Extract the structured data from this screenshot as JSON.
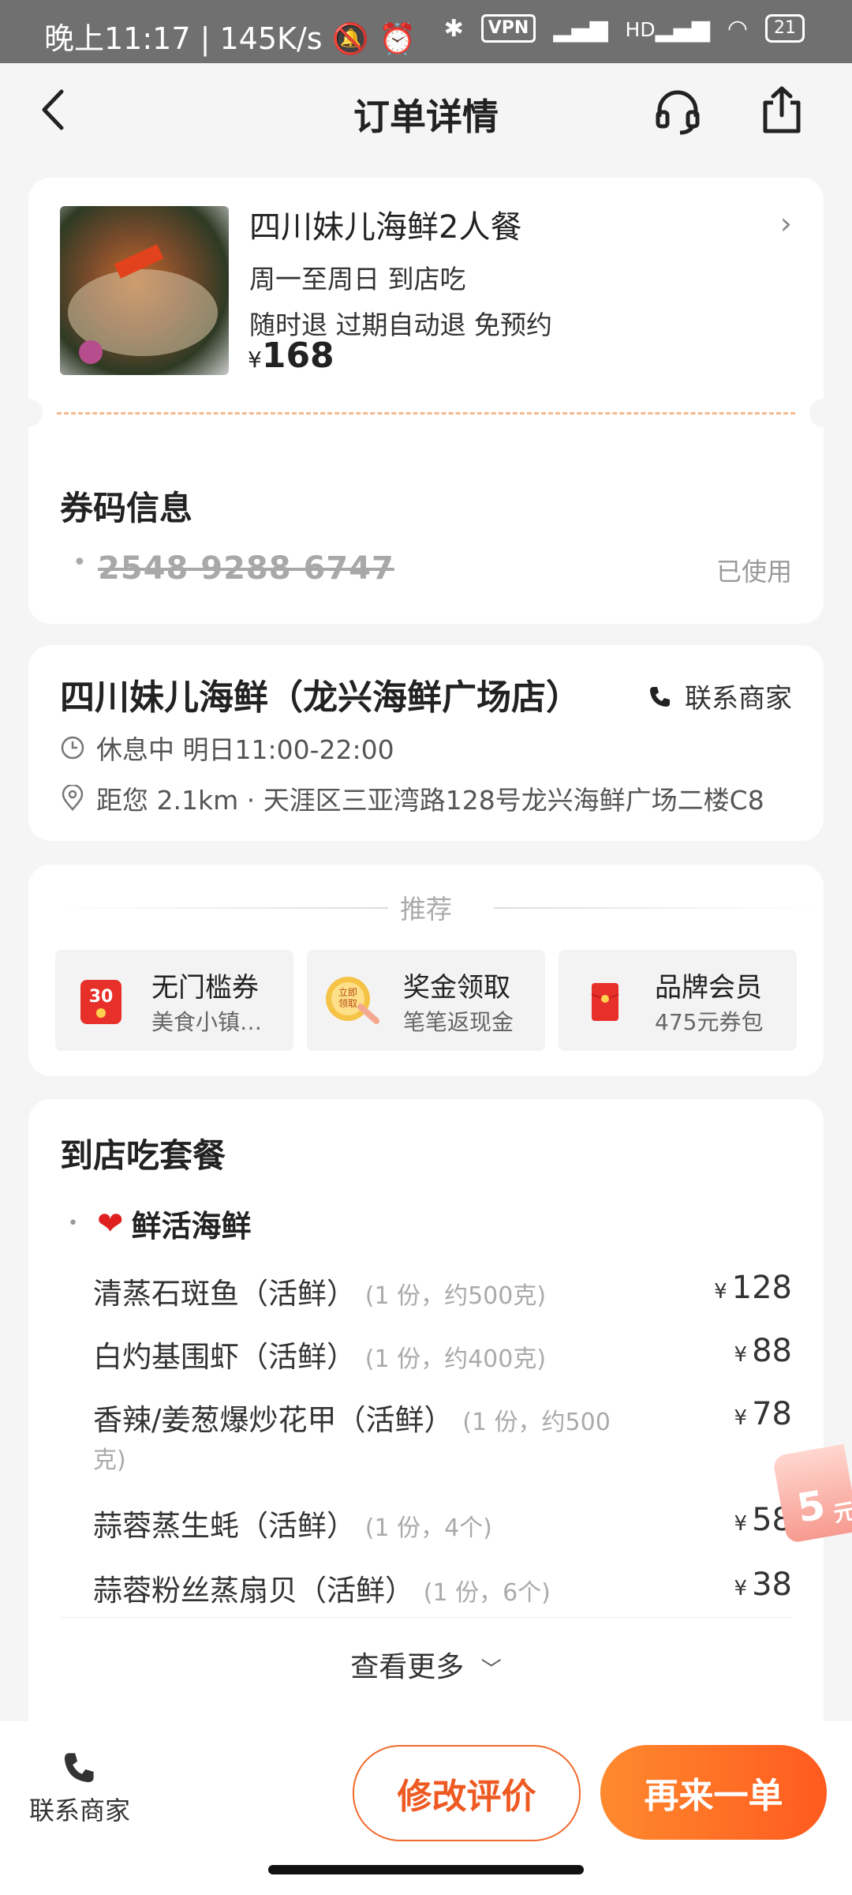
{
  "status_bar": {
    "time": "晚上11:17",
    "speed": "145K/s",
    "vpn": "VPN",
    "hd": "HD",
    "battery": "21"
  },
  "header": {
    "title": "订单详情"
  },
  "product": {
    "name": "四川妹儿海鲜2人餐",
    "line1": "周一至周日   到店吃",
    "line2": "随时退   过期自动退   免预约",
    "currency": "¥",
    "price": "168"
  },
  "coupon": {
    "title": "券码信息",
    "code": "2548 9288 6747",
    "status": "已使用"
  },
  "shop": {
    "name": "四川妹儿海鲜（龙兴海鲜广场店）",
    "contact": "联系商家",
    "hours": "休息中 明日11:00-22:00",
    "address": "距您 2.1km · 天涯区三亚湾路128号龙兴海鲜广场二楼C8"
  },
  "recommend": {
    "label": "推荐",
    "items": [
      {
        "title": "无门槛券",
        "sub": "美食小镇…",
        "icon": "coupon-30-icon",
        "badge": "30"
      },
      {
        "title": "奖金领取",
        "sub": "笔笔返现金",
        "icon": "bonus-claim-icon",
        "badge": "立即领取"
      },
      {
        "title": "品牌会员",
        "sub": "475元券包",
        "icon": "red-packet-icon"
      }
    ]
  },
  "package": {
    "title": "到店吃套餐",
    "category": "鲜活海鲜",
    "items": [
      {
        "name": "清蒸石斑鱼（活鲜）",
        "note": "(1 份，约500克)",
        "price": "128"
      },
      {
        "name": "白灼基围虾（活鲜）",
        "note": "(1 份，约400克)",
        "price": "88"
      },
      {
        "name": "香辣/姜葱爆炒花甲（活鲜）",
        "note": "(1 份，约500",
        "note2": "克)",
        "price": "78"
      },
      {
        "name": "蒜蓉蒸生蚝（活鲜）",
        "note": "(1 份，4个)",
        "price": "58"
      },
      {
        "name": "蒜蓉粉丝蒸扇贝（活鲜）",
        "note": "(1 份，6个)",
        "price": "38"
      }
    ],
    "currency": "¥",
    "more": "查看更多"
  },
  "float_red_packet": {
    "amount": "5",
    "unit": "元"
  },
  "bottom_bar": {
    "contact": "联系商家",
    "edit_review": "修改评价",
    "reorder": "再来一单"
  },
  "colors": {
    "accent": "#ff5a1f",
    "background": "#f5f5f5"
  }
}
